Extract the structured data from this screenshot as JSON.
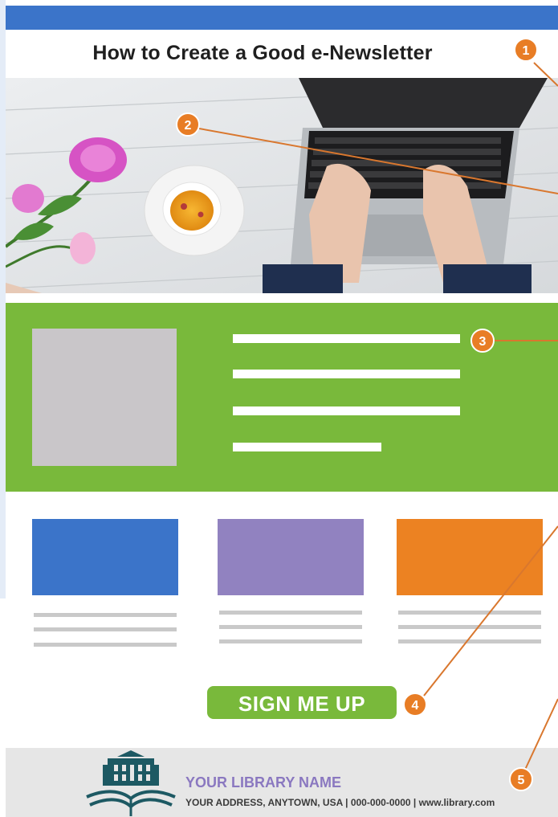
{
  "newsletter": {
    "title": "How to Create a Good e-Newsletter",
    "signup_label": "SIGN ME UP",
    "footer": {
      "library_name": "YOUR LIBRARY NAME",
      "address_line": "YOUR ADDRESS, ANYTOWN, USA | 000-000-0000 | www.library.com"
    }
  },
  "callouts": [
    "1",
    "2",
    "3",
    "4",
    "5"
  ],
  "colors": {
    "header_blue": "#3b74c9",
    "section_green": "#79b93b",
    "card_blue": "#3b74c9",
    "card_purple": "#9182c0",
    "card_orange": "#ec8222",
    "callout_orange": "#e87d25",
    "footer_gray": "#e6e6e6",
    "library_name_purple": "#8a78c0"
  },
  "icons": {
    "library_logo": "library-building-book-icon"
  }
}
